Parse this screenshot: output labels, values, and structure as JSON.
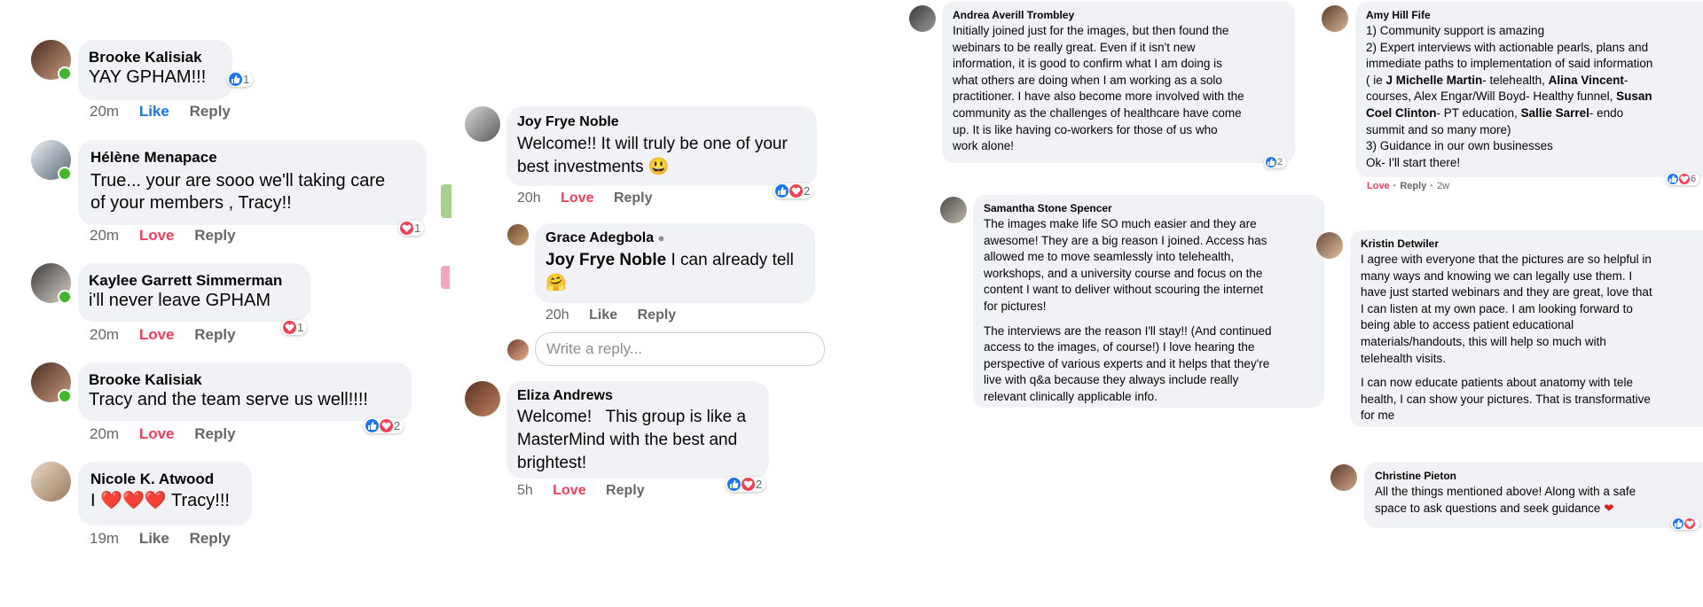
{
  "col1": [
    {
      "name": "Brooke Kalisiak",
      "text": "YAY GPHAM!!!",
      "time": "20m",
      "action1": "Like",
      "action2": "Reply",
      "react_count": "1",
      "react": "like"
    },
    {
      "name": "Hélène Menapace",
      "line1": "True... your are sooo we'll taking care",
      "line2": "of your members , Tracy!!",
      "time": "20m",
      "action1": "Love",
      "action2": "Reply",
      "react_count": "1",
      "react": "love"
    },
    {
      "name": "Kaylee Garrett Simmerman",
      "text": "i'll never leave GPHAM",
      "time": "20m",
      "action1": "Love",
      "action2": "Reply",
      "react_count": "1",
      "react": "love"
    },
    {
      "name": "Brooke Kalisiak",
      "text": "Tracy and the team serve us well!!!!",
      "time": "20m",
      "action1": "Love",
      "action2": "Reply",
      "react_count": "2",
      "react": "both"
    },
    {
      "name": "Nicole K. Atwood",
      "text_pre": "I ",
      "hearts": "❤️❤️❤️",
      "text_post": " Tracy!!!",
      "time": "19m",
      "action1": "Like",
      "action2": "Reply"
    }
  ],
  "col2": {
    "joy": {
      "name": "Joy Frye Noble",
      "line1": "Welcome!! It will truly be one of your",
      "line2": "best investments 😃",
      "time": "20h",
      "action1": "Love",
      "action2": "Reply",
      "react_count": "2"
    },
    "grace": {
      "name": "Grace Adegbola",
      "mention": "Joy Frye Noble",
      "line1": " I can already tell",
      "line2": "🤗",
      "time": "20h",
      "action1": "Like",
      "action2": "Reply"
    },
    "reply_placeholder": "Write a reply...",
    "eliza": {
      "name": "Eliza Andrews",
      "line1": "Welcome!   This group is like a",
      "line2": "MasterMind with the best and",
      "line3": "brightest!",
      "time": "5h",
      "action1": "Love",
      "action2": "Reply",
      "react_count": "2"
    }
  },
  "col3": {
    "andrea": {
      "name": "Andrea Averill Trombley",
      "lines": [
        "Initially joined just for the images, but then found the",
        "webinars to be really great. Even if it isn't new",
        "information, it is good to confirm what I am doing is",
        "what others are doing when I am working as a solo",
        "practitioner. I have also become more involved with the",
        "community as the challenges of healthcare have come",
        "up. It is like having co-workers for those of us who",
        "work alone!"
      ],
      "react_count": "2"
    },
    "samantha": {
      "name": "Samantha Stone Spencer",
      "para1": [
        "The images make life SO much easier and they are",
        "awesome! They are a big reason I joined. Access has",
        "allowed me to move seamlessly into telehealth,",
        "workshops, and a university course and focus on the",
        "content I want to deliver without scouring the internet",
        "for pictures!"
      ],
      "para2": [
        "The interviews are the reason I'll stay!! (And continued",
        "access to the images, of course!) I love hearing the",
        "perspective of various experts and it helps that they're",
        "live with q&a because they always include really",
        "relevant clinically applicable info."
      ]
    }
  },
  "col4": {
    "amy": {
      "name": "Amy Hill Fife",
      "line1": "1) Community support is amazing",
      "line2": "2) Expert interviews with actionable pearls, plans and",
      "line3": "immediate paths to implementation of said information",
      "line4_a": "( ie ",
      "line4_b": "J Michelle Martin",
      "line4_c": "- telehealth, ",
      "line4_d": "Alina Vincent",
      "line4_e": "-",
      "line5": "courses, Alex Engar/Will Boyd- Healthy funnel, ",
      "line5_b": "Susan",
      "line6_a": "Coel Clinton",
      "line6_b": "- PT education, ",
      "line6_c": "Sallie Sarrel",
      "line6_d": "- endo",
      "line7": "summit and so many more)",
      "line8": "3) Guidance in our own businesses",
      "line9": "Ok- I'll start there!",
      "action1": "Love",
      "action2": "Reply",
      "time": "2w",
      "react_count": "6"
    },
    "kristin": {
      "name": "Kristin Detwiler",
      "para1": [
        "I agree with everyone that the pictures are so helpful in",
        "many ways and knowing we can legally use them. I",
        "have just started webinars and they are great, love that",
        "I can listen at my own pace. I am looking forward to",
        "being able to access patient educational",
        "materials/handouts, this will help so much with",
        "telehealth visits."
      ],
      "para2": [
        "I can now educate patients about anatomy with tele",
        "health, I can show your pictures. That is transformative",
        "for me"
      ]
    },
    "christine": {
      "name": "Christine Pieton",
      "line1": "All the things mentioned above! Along with a safe",
      "line2_text": "space to ask questions and seek guidance ",
      "line2_heart": "❤"
    }
  }
}
